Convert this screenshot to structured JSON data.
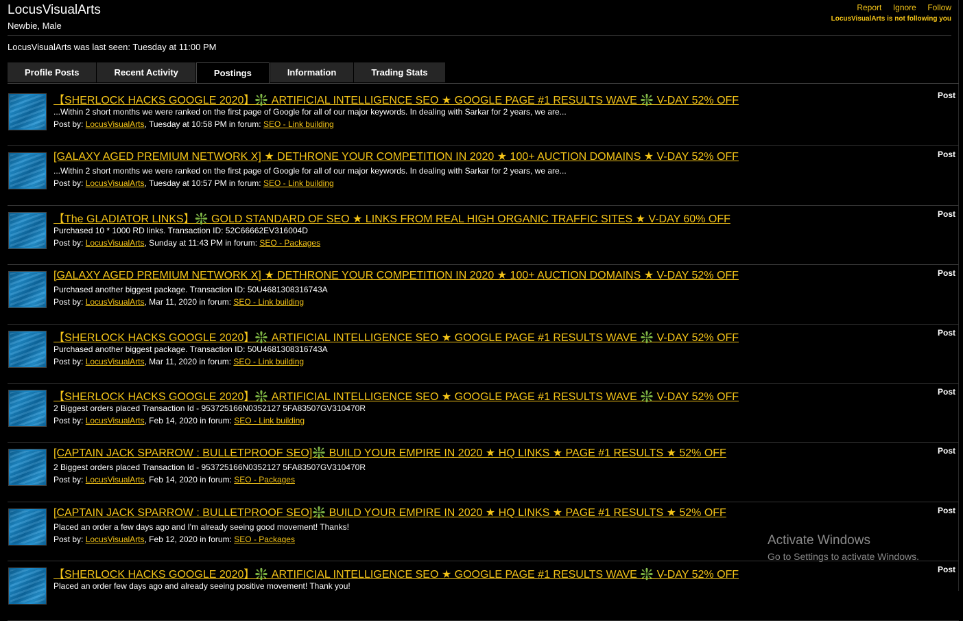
{
  "profile": {
    "username": "LocusVisualArts",
    "user_title": "Newbie, Male",
    "last_seen": "LocusVisualArts was last seen: Tuesday at 11:00 PM"
  },
  "top_links": {
    "report": "Report",
    "ignore": "Ignore",
    "follow": "Follow",
    "follow_status": "LocusVisualArts is not following you"
  },
  "tabs": [
    {
      "label": "Profile Posts"
    },
    {
      "label": "Recent Activity"
    },
    {
      "label": "Postings",
      "active": true
    },
    {
      "label": "Information"
    },
    {
      "label": "Trading Stats"
    }
  ],
  "post_meta_labels": {
    "by": "Post by: ",
    "in_forum": " in forum: "
  },
  "posts": [
    {
      "title": "【SHERLOCK HACKS GOOGLE 2020】❇️ ARTIFICIAL INTELLIGENCE SEO ★ GOOGLE PAGE #1 RESULTS WAVE ❇️ V-DAY 52% OFF",
      "snippet": "...Within 2 short months we were ranked on the first page of Google for all of our major keywords. In dealing with Sarkar for 2 years, we are...",
      "author": "LocusVisualArts",
      "date": ", Tuesday at 10:58 PM",
      "forum": "SEO - Link building",
      "type": "Post"
    },
    {
      "title": "[GALAXY AGED PREMIUM NETWORK X] ★ DETHRONE YOUR COMPETITION IN 2020 ★ 100+ AUCTION DOMAINS ★ V-DAY 52% OFF",
      "snippet": "...Within 2 short months we were ranked on the first page of Google for all of our major keywords. In dealing with Sarkar for 2 years, we are...",
      "author": "LocusVisualArts",
      "date": ", Tuesday at 10:57 PM",
      "forum": "SEO - Link building",
      "type": "Post"
    },
    {
      "title": "【The GLADIATOR LINKS】❇️ GOLD STANDARD OF SEO ★ LINKS FROM REAL HIGH ORGANIC TRAFFIC SITES ★ V-DAY 60% OFF",
      "snippet": "Purchased 10 * 1000 RD links. Transaction ID: 52C66662EV316004D",
      "author": "LocusVisualArts",
      "date": ", Sunday at 11:43 PM",
      "forum": "SEO - Packages",
      "type": "Post"
    },
    {
      "title": "[GALAXY AGED PREMIUM NETWORK X] ★ DETHRONE YOUR COMPETITION IN 2020 ★ 100+ AUCTION DOMAINS ★ V-DAY 52% OFF",
      "snippet": "Purchased another biggest package. Transaction ID: 50U4681308316743A",
      "author": "LocusVisualArts",
      "date": ", Mar 11, 2020",
      "forum": "SEO - Link building",
      "type": "Post"
    },
    {
      "title": "【SHERLOCK HACKS GOOGLE 2020】❇️ ARTIFICIAL INTELLIGENCE SEO ★ GOOGLE PAGE #1 RESULTS WAVE ❇️ V-DAY 52% OFF",
      "snippet": "Purchased another biggest package. Transaction ID: 50U4681308316743A",
      "author": "LocusVisualArts",
      "date": ", Mar 11, 2020",
      "forum": "SEO - Link building",
      "type": "Post"
    },
    {
      "title": "【SHERLOCK HACKS GOOGLE 2020】❇️ ARTIFICIAL INTELLIGENCE SEO ★ GOOGLE PAGE #1 RESULTS WAVE ❇️ V-DAY 52% OFF",
      "snippet": "2 Biggest orders placed Transaction Id - 953725166N0352127 5FA83507GV310470R",
      "author": "LocusVisualArts",
      "date": ", Feb 14, 2020",
      "forum": "SEO - Link building",
      "type": "Post"
    },
    {
      "title": "[CAPTAIN JACK SPARROW : BULLETPROOF SEO]❇️ BUILD YOUR EMPIRE IN 2020 ★ HQ LINKS ★ PAGE #1 RESULTS ★ 52% OFF",
      "snippet": "2 Biggest orders placed Transaction Id - 953725166N0352127 5FA83507GV310470R",
      "author": "LocusVisualArts",
      "date": ", Feb 14, 2020",
      "forum": "SEO - Packages",
      "type": "Post"
    },
    {
      "title": "[CAPTAIN JACK SPARROW : BULLETPROOF SEO]❇️ BUILD YOUR EMPIRE IN 2020 ★ HQ LINKS ★ PAGE #1 RESULTS ★ 52% OFF",
      "snippet": "Placed an order a few days ago and I'm already seeing good movement! Thanks!",
      "author": "LocusVisualArts",
      "date": ", Feb 12, 2020",
      "forum": "SEO - Packages",
      "type": "Post"
    },
    {
      "title": "【SHERLOCK HACKS GOOGLE 2020】❇️ ARTIFICIAL INTELLIGENCE SEO ★ GOOGLE PAGE #1 RESULTS WAVE ❇️ V-DAY 52% OFF",
      "snippet": "Placed an order few days ago and already seeing positive movement! Thank you!",
      "author": "",
      "date": "",
      "forum": "",
      "type": "Post"
    }
  ],
  "watermark": {
    "line1": "Activate Windows",
    "line2": "Go to Settings to activate Windows."
  }
}
